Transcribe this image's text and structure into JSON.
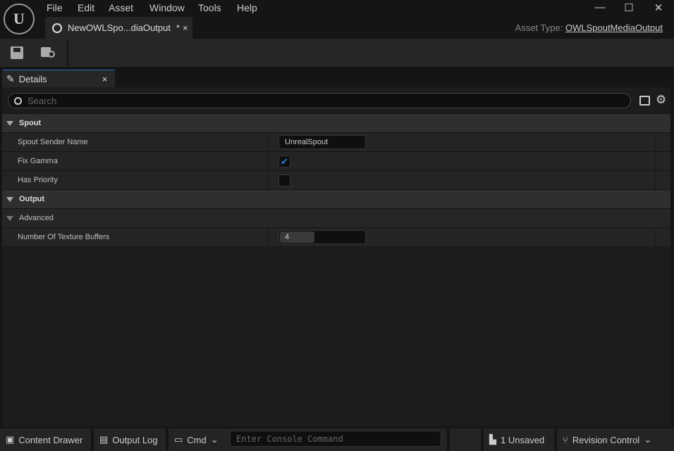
{
  "menu": [
    "File",
    "Edit",
    "Asset",
    "Window",
    "Tools",
    "Help"
  ],
  "doc_tab": {
    "label": "NewOWLSpo...diaOutput",
    "modified": "*",
    "close": "×"
  },
  "asset_type": {
    "label": "Asset Type:",
    "value": "OWLSpoutMediaOutput"
  },
  "window": {
    "minimize": "—",
    "maximize": "☐",
    "close": "✕"
  },
  "details_tab": {
    "label": "Details",
    "close": "×"
  },
  "search": {
    "placeholder": "Search"
  },
  "categories": {
    "spout": "Spout",
    "output": "Output",
    "advanced": "Advanced"
  },
  "properties": {
    "spout_sender_name": {
      "label": "Spout Sender Name",
      "value": "UnrealSpout"
    },
    "fix_gamma": {
      "label": "Fix Gamma",
      "checked": true
    },
    "has_priority": {
      "label": "Has Priority",
      "checked": false
    },
    "num_texture_buffers": {
      "label": "Number Of Texture Buffers",
      "value": "4",
      "slider_fraction": 0.4
    }
  },
  "status": {
    "content_drawer": "Content Drawer",
    "output_log": "Output Log",
    "cmd": "Cmd",
    "console_placeholder": "Enter Console Command",
    "unsaved": "1 Unsaved",
    "revision_control": "Revision Control"
  },
  "colors": {
    "accent": "#2a80e8"
  }
}
